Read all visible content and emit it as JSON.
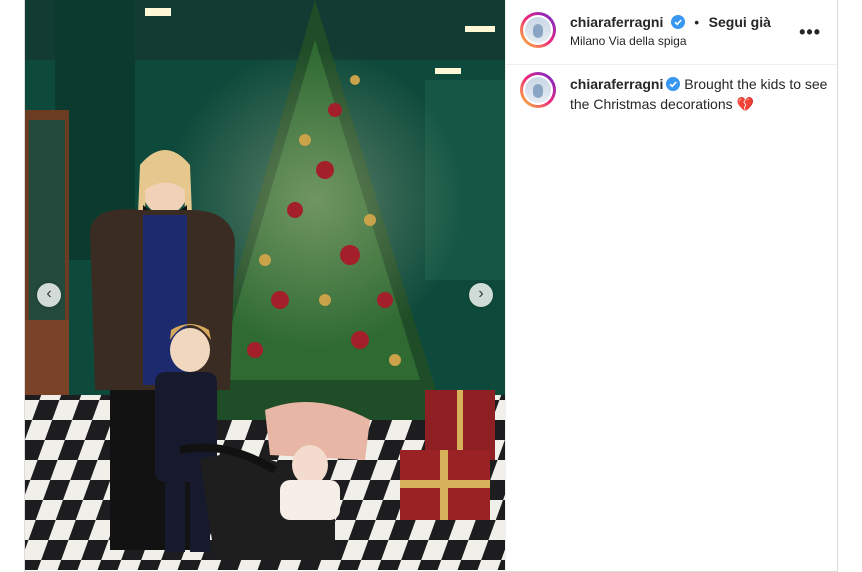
{
  "post": {
    "username": "chiaraferragni",
    "follow_label": "Segui già",
    "location": "Milano Via della spiga",
    "more_label": "•••",
    "caption_user": "chiaraferragni",
    "caption_text": "Brought the kids to see the Christmas decorations",
    "emoji": "💔"
  },
  "carousel": {
    "prev_label": "‹",
    "next_label": "›"
  }
}
